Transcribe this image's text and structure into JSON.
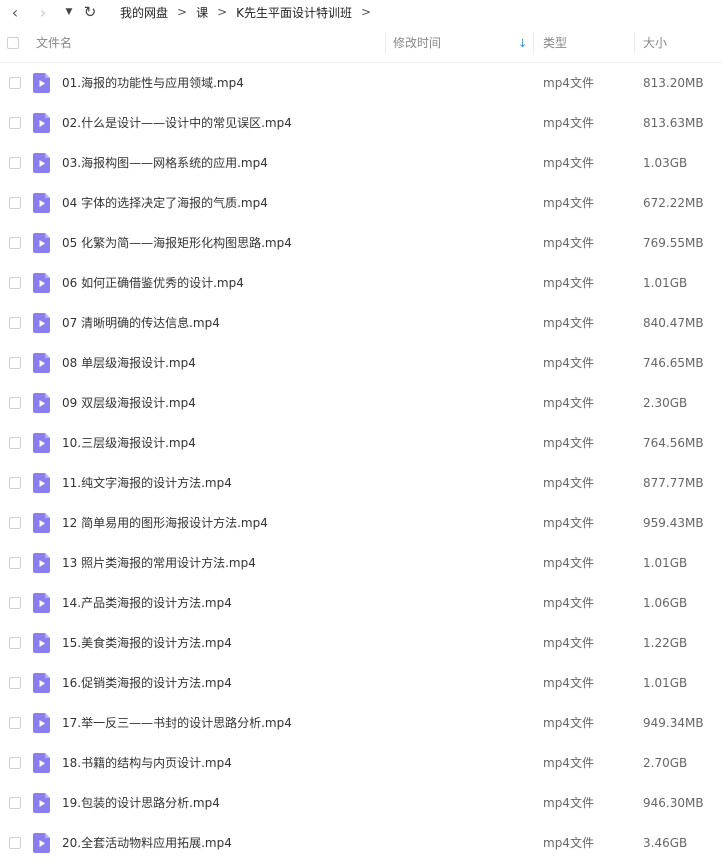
{
  "nav": {
    "back_icon": "chevron-left-icon",
    "forward_icon": "chevron-right-icon",
    "dropdown_icon": "caret-down-icon",
    "refresh_icon": "refresh-icon"
  },
  "breadcrumb": {
    "items": [
      "我的网盘",
      "课",
      "K先生平面设计特训班"
    ],
    "separator": ">"
  },
  "table": {
    "headers": {
      "name": "文件名",
      "modified": "修改时间",
      "type": "类型",
      "size": "大小"
    },
    "sort_icon": "arrow-down-icon",
    "accent_color": "#3a8ee6",
    "file_icon_color": "#8b7ff0",
    "rows": [
      {
        "name": "01.海报的功能性与应用领域.mp4",
        "type": "mp4文件",
        "size": "813.20MB"
      },
      {
        "name": "02.什么是设计——设计中的常见误区.mp4",
        "type": "mp4文件",
        "size": "813.63MB"
      },
      {
        "name": "03.海报构图——网格系统的应用.mp4",
        "type": "mp4文件",
        "size": "1.03GB"
      },
      {
        "name": "04 字体的选择决定了海报的气质.mp4",
        "type": "mp4文件",
        "size": "672.22MB"
      },
      {
        "name": "05 化繁为简——海报矩形化构图思路.mp4",
        "type": "mp4文件",
        "size": "769.55MB"
      },
      {
        "name": "06 如何正确借鉴优秀的设计.mp4",
        "type": "mp4文件",
        "size": "1.01GB"
      },
      {
        "name": "07 清晰明确的传达信息.mp4",
        "type": "mp4文件",
        "size": "840.47MB"
      },
      {
        "name": "08 单层级海报设计.mp4",
        "type": "mp4文件",
        "size": "746.65MB"
      },
      {
        "name": "09 双层级海报设计.mp4",
        "type": "mp4文件",
        "size": "2.30GB"
      },
      {
        "name": "10.三层级海报设计.mp4",
        "type": "mp4文件",
        "size": "764.56MB"
      },
      {
        "name": "11.纯文字海报的设计方法.mp4",
        "type": "mp4文件",
        "size": "877.77MB"
      },
      {
        "name": "12 简单易用的图形海报设计方法.mp4",
        "type": "mp4文件",
        "size": "959.43MB"
      },
      {
        "name": "13 照片类海报的常用设计方法.mp4",
        "type": "mp4文件",
        "size": "1.01GB"
      },
      {
        "name": "14.产品类海报的设计方法.mp4",
        "type": "mp4文件",
        "size": "1.06GB"
      },
      {
        "name": "15.美食类海报的设计方法.mp4",
        "type": "mp4文件",
        "size": "1.22GB"
      },
      {
        "name": "16.促销类海报的设计方法.mp4",
        "type": "mp4文件",
        "size": "1.01GB"
      },
      {
        "name": "17.举一反三——书封的设计思路分析.mp4",
        "type": "mp4文件",
        "size": "949.34MB"
      },
      {
        "name": "18.书籍的结构与内页设计.mp4",
        "type": "mp4文件",
        "size": "2.70GB"
      },
      {
        "name": "19.包装的设计思路分析.mp4",
        "type": "mp4文件",
        "size": "946.30MB"
      },
      {
        "name": "20.全套活动物料应用拓展.mp4",
        "type": "mp4文件",
        "size": "3.46GB"
      }
    ]
  }
}
